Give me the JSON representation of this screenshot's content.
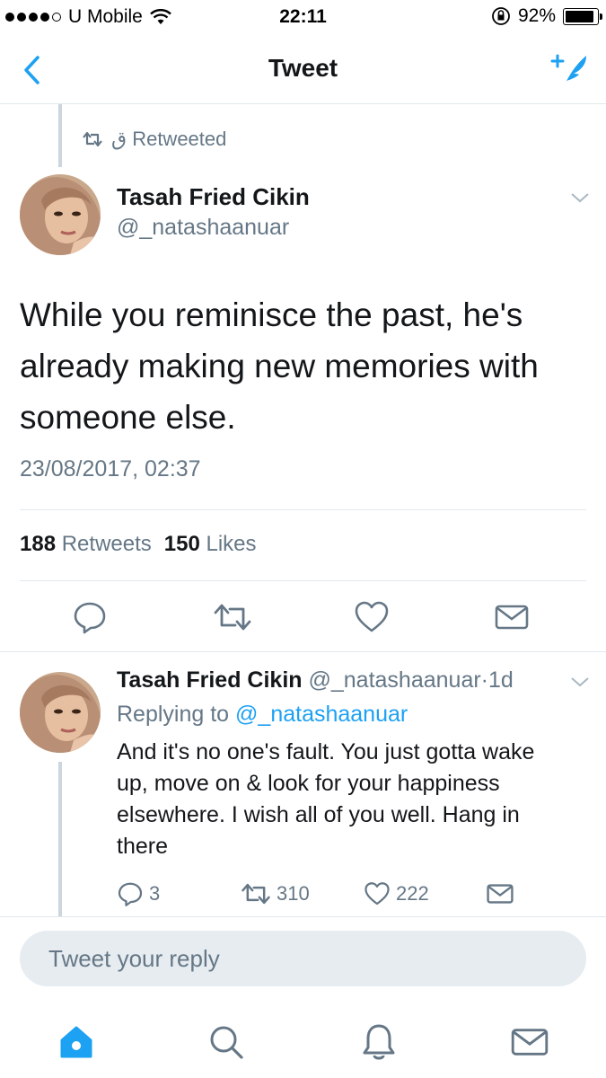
{
  "status_bar": {
    "carrier": "U Mobile",
    "time": "22:11",
    "battery": "92%",
    "battery_level": 0.92
  },
  "nav": {
    "title": "Tweet",
    "back_icon": "chevron-left-icon",
    "compose_icon": "compose-tweet-icon"
  },
  "retweet_context": {
    "label": "ق Retweeted"
  },
  "tweet": {
    "author_name": "Tasah Fried Cikin",
    "author_handle": "@_natashaanuar",
    "text": "While you reminisce the past, he's already making new memories with someone else.",
    "date": "23/08/2017, 02:37",
    "retweets_count": "188",
    "retweets_label": "Retweets",
    "likes_count": "150",
    "likes_label": "Likes"
  },
  "reply": {
    "author_name": "Tasah Fried Cikin",
    "author_handle": "@_natashaanuar",
    "separator": "·",
    "age": "1d",
    "replying_prefix": "Replying to",
    "replying_to": "@_natashaanuar",
    "text": "And it's no one's fault. You just gotta wake up, move on & look for your happiness elsewhere. I wish all of you well. Hang in there",
    "replies_count": "3",
    "retweets_count": "310",
    "likes_count": "222"
  },
  "reply_box": {
    "placeholder": "Tweet your reply"
  },
  "tab_bar": {
    "items": [
      "home-icon",
      "search-icon",
      "notifications-bell-icon",
      "messages-icon"
    ],
    "active": "home-icon"
  },
  "colors": {
    "accent": "#1da1f2",
    "secondary_text": "#657786",
    "divider": "#e1e8ed"
  }
}
